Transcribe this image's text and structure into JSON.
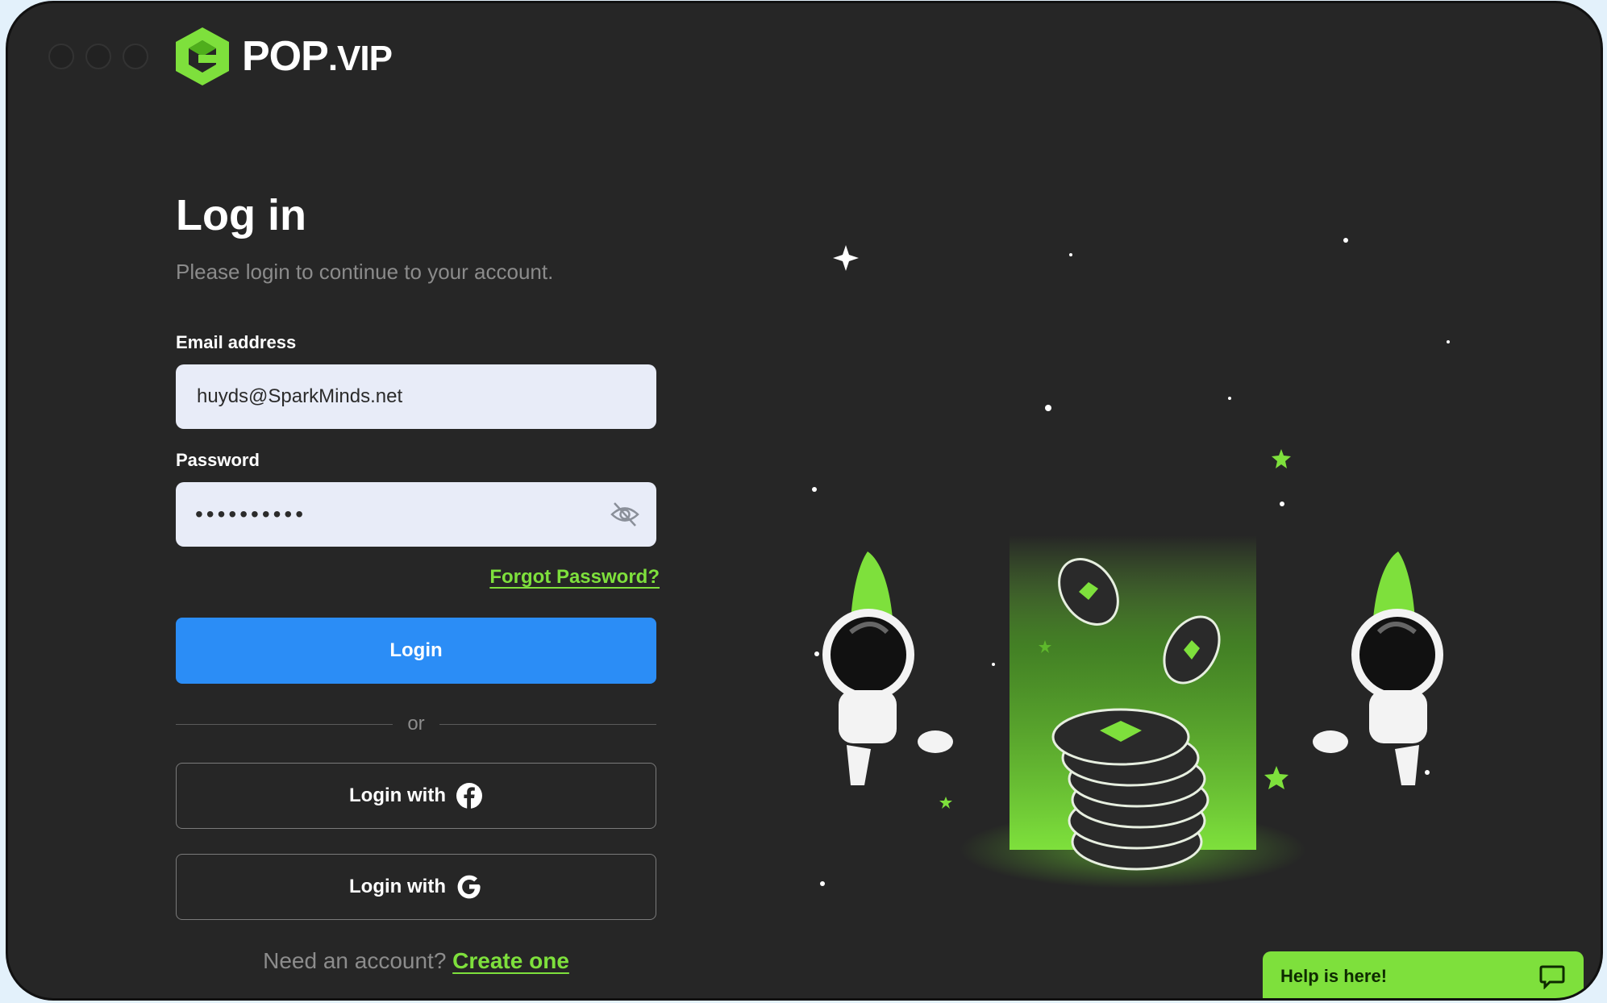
{
  "brand": {
    "name_main": "POP",
    "name_suffix": ".VIP",
    "accent_color": "#7ee03c"
  },
  "login": {
    "title": "Log in",
    "subtitle": "Please login to continue to your account.",
    "email_label": "Email address",
    "email_value": "huyds@SparkMinds.net",
    "password_label": "Password",
    "password_value": "••••••••••",
    "forgot_link": "Forgot Password?",
    "login_button": "Login",
    "divider_text": "or",
    "facebook_button": "Login with",
    "google_button": "Login with",
    "signup_prompt": "Need an account?",
    "signup_link": "Create one"
  },
  "help": {
    "label": "Help is here!"
  },
  "icons": {
    "logo": "pop-vip-logo-icon",
    "eye": "eye-off-icon",
    "facebook": "facebook-icon",
    "google": "google-icon",
    "chat": "chat-icon"
  },
  "colors": {
    "primary_button": "#2b8df6",
    "accent": "#7ee03c",
    "background": "#262626"
  }
}
